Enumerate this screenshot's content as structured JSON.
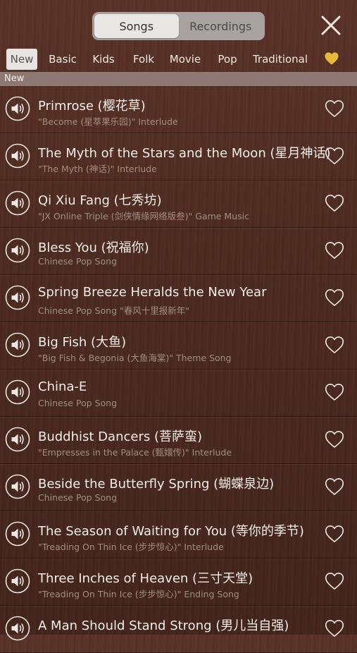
{
  "header": {
    "tabs": [
      {
        "label": "Songs",
        "active": true
      },
      {
        "label": "Recordings",
        "active": false
      }
    ]
  },
  "categories": [
    {
      "label": "New",
      "active": true
    },
    {
      "label": "Basic"
    },
    {
      "label": "Kids"
    },
    {
      "label": "Folk"
    },
    {
      "label": "Movie"
    },
    {
      "label": "Pop"
    },
    {
      "label": "Traditional"
    }
  ],
  "section_label": "New",
  "songs": [
    {
      "title": "Primrose (樱花草)",
      "subtitle": "\"Become (星萃果乐园)\" Interlude"
    },
    {
      "title": "The Myth of the Stars and the Moon (星月神话)",
      "subtitle": "\"The Myth (神话)\" Interlude"
    },
    {
      "title": "Qi Xiu Fang (七秀坊)",
      "subtitle": "\"JX Online Triple (剑侠情缘网络版叁)\" Game Music"
    },
    {
      "title": "Bless You (祝福你)",
      "subtitle": "Chinese Pop Song"
    },
    {
      "title": "Spring Breeze Heralds the New Year",
      "subtitle": "Chinese Pop Song \"春风十里报新年\""
    },
    {
      "title": "Big Fish (大鱼)",
      "subtitle": "\"Big Fish & Begonia (大鱼海棠)\" Theme Song"
    },
    {
      "title": "China-E",
      "subtitle": "Chinese Pop Song"
    },
    {
      "title": "Buddhist Dancers (菩萨蛮)",
      "subtitle": "\"Empresses in the Palace (甄嬛传)\" Interlude"
    },
    {
      "title": "Beside the Butterfly Spring (蝴蝶泉边)",
      "subtitle": "Chinese Pop Song"
    },
    {
      "title": "The Season of Waiting for You (等你的季节)",
      "subtitle": "\"Treading On Thin Ice (步步惊心)\" Interlude"
    },
    {
      "title": "Three Inches of Heaven (三寸天堂)",
      "subtitle": "\"Treading On Thin Ice (步步惊心)\" Ending Song"
    },
    {
      "title": "A Man Should Stand Strong (男儿当自强)",
      "subtitle": ""
    }
  ],
  "colors": {
    "favorite_filter": "#e7b93a",
    "background": "#4d2a20",
    "section_bar": "#8d7872"
  }
}
